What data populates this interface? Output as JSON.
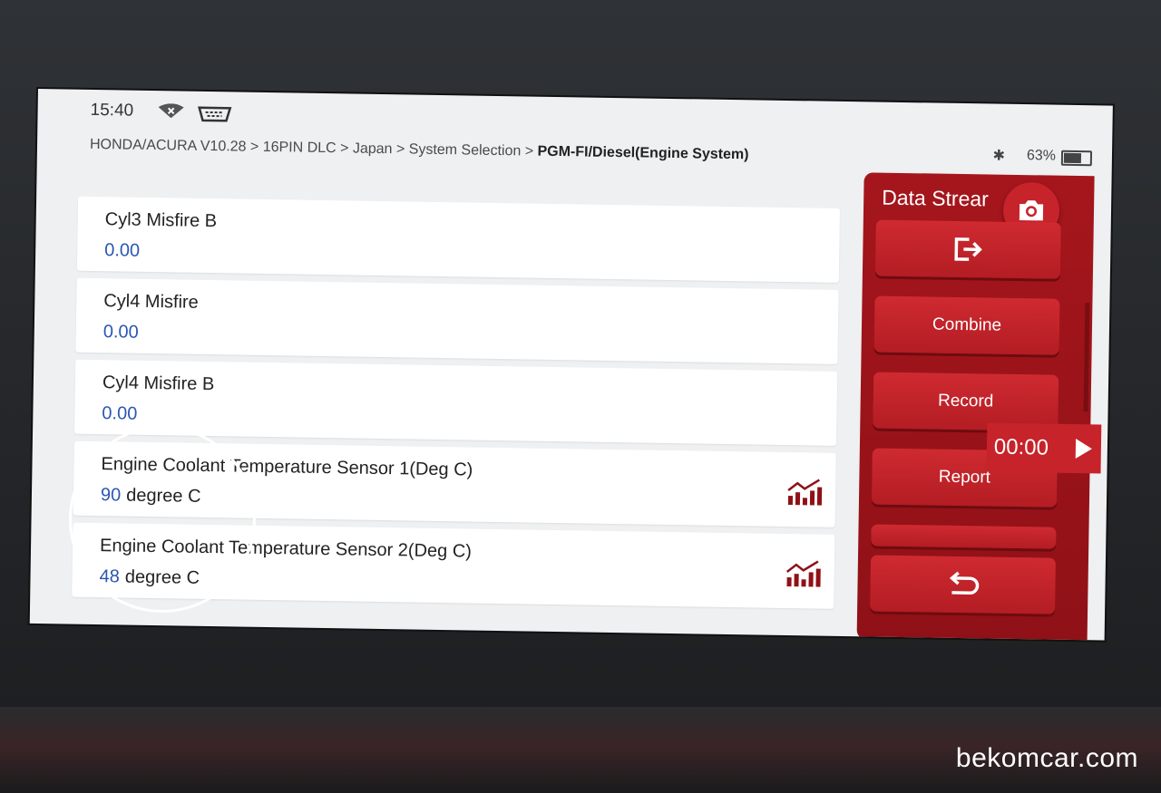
{
  "status_bar": {
    "time": "15:40",
    "battery": "63%"
  },
  "breadcrumb": {
    "path": "HONDA/ACURA V10.28 > 16PIN DLC > Japan > System Selection > ",
    "current": "PGM-FI/Diesel(Engine System)"
  },
  "data_items": [
    {
      "name": "Cyl3 Misfire B",
      "value": "0.00",
      "unit": ""
    },
    {
      "name": "Cyl4 Misfire",
      "value": "0.00",
      "unit": ""
    },
    {
      "name": "Cyl4 Misfire B",
      "value": "0.00",
      "unit": ""
    },
    {
      "name": "Engine Coolant Temperature Sensor 1(Deg C)",
      "value": "90",
      "unit": "degree C"
    },
    {
      "name": "Engine Coolant Temperature Sensor 2(Deg C)",
      "value": "48",
      "unit": "degree C"
    }
  ],
  "side_panel": {
    "title": "Data Strear",
    "combine_label": "Combine",
    "record_label": "Record",
    "report_label": "Report",
    "timer": "00:00"
  },
  "watermark": "bekomcar.com",
  "colors": {
    "accent": "#b31d23",
    "value_text": "#2a55b5"
  }
}
